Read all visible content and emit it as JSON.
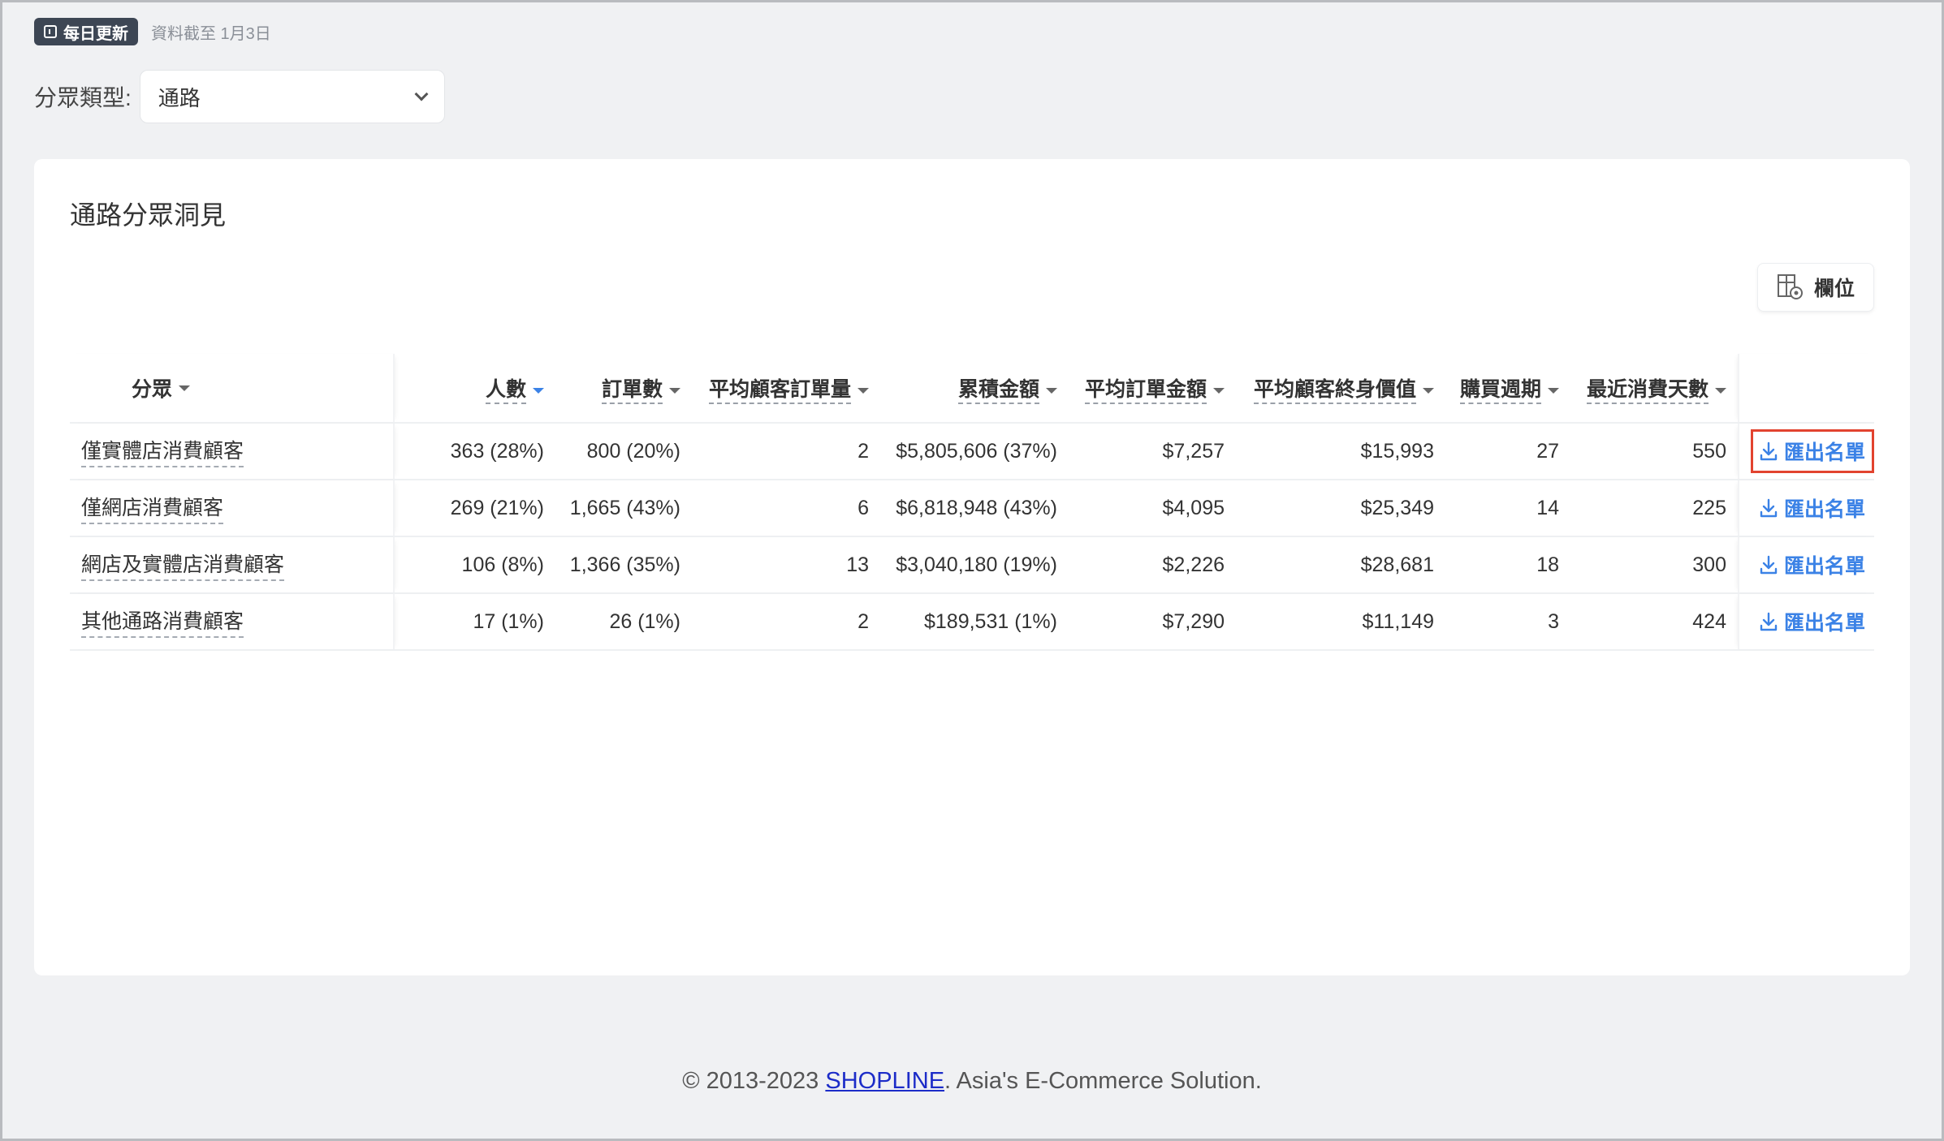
{
  "update": {
    "badge": "每日更新",
    "text": "資料截至 1月3日"
  },
  "segment_type": {
    "label": "分眾類型:",
    "value": "通路"
  },
  "card": {
    "title": "通路分眾洞見",
    "columns_button": "欄位"
  },
  "table": {
    "headers": {
      "segment": "分眾",
      "people": "人數",
      "orders": "訂單數",
      "avg_orders": "平均顧客訂單量",
      "total_amount": "累積金額",
      "avg_order_amount": "平均訂單金額",
      "avg_ltv": "平均顧客終身價值",
      "purchase_cycle": "購買週期",
      "last_purchase_days": "最近消費天數"
    },
    "rows": [
      {
        "segment": "僅實體店消費顧客",
        "people": "363 (28%)",
        "orders": "800 (20%)",
        "avg_orders": "2",
        "total_amount": "$5,805,606 (37%)",
        "avg_order_amount": "$7,257",
        "avg_ltv": "$15,993",
        "purchase_cycle": "27",
        "last_purchase_days": "550",
        "action": "匯出名單"
      },
      {
        "segment": "僅網店消費顧客",
        "people": "269 (21%)",
        "orders": "1,665 (43%)",
        "avg_orders": "6",
        "total_amount": "$6,818,948 (43%)",
        "avg_order_amount": "$4,095",
        "avg_ltv": "$25,349",
        "purchase_cycle": "14",
        "last_purchase_days": "225",
        "action": "匯出名單"
      },
      {
        "segment": "網店及實體店消費顧客",
        "people": "106 (8%)",
        "orders": "1,366 (35%)",
        "avg_orders": "13",
        "total_amount": "$3,040,180 (19%)",
        "avg_order_amount": "$2,226",
        "avg_ltv": "$28,681",
        "purchase_cycle": "18",
        "last_purchase_days": "300",
        "action": "匯出名單"
      },
      {
        "segment": "其他通路消費顧客",
        "people": "17 (1%)",
        "orders": "26 (1%)",
        "avg_orders": "2",
        "total_amount": "$189,531 (1%)",
        "avg_order_amount": "$7,290",
        "avg_ltv": "$11,149",
        "purchase_cycle": "3",
        "last_purchase_days": "424",
        "action": "匯出名單"
      }
    ]
  },
  "footer": {
    "prefix": "© 2013-2023 ",
    "link": "SHOPLINE",
    "suffix": ". Asia's E-Commerce Solution."
  },
  "colors": {
    "accent": "#3b82e6",
    "highlight": "#e2432f",
    "badge_bg": "#3d4654"
  }
}
